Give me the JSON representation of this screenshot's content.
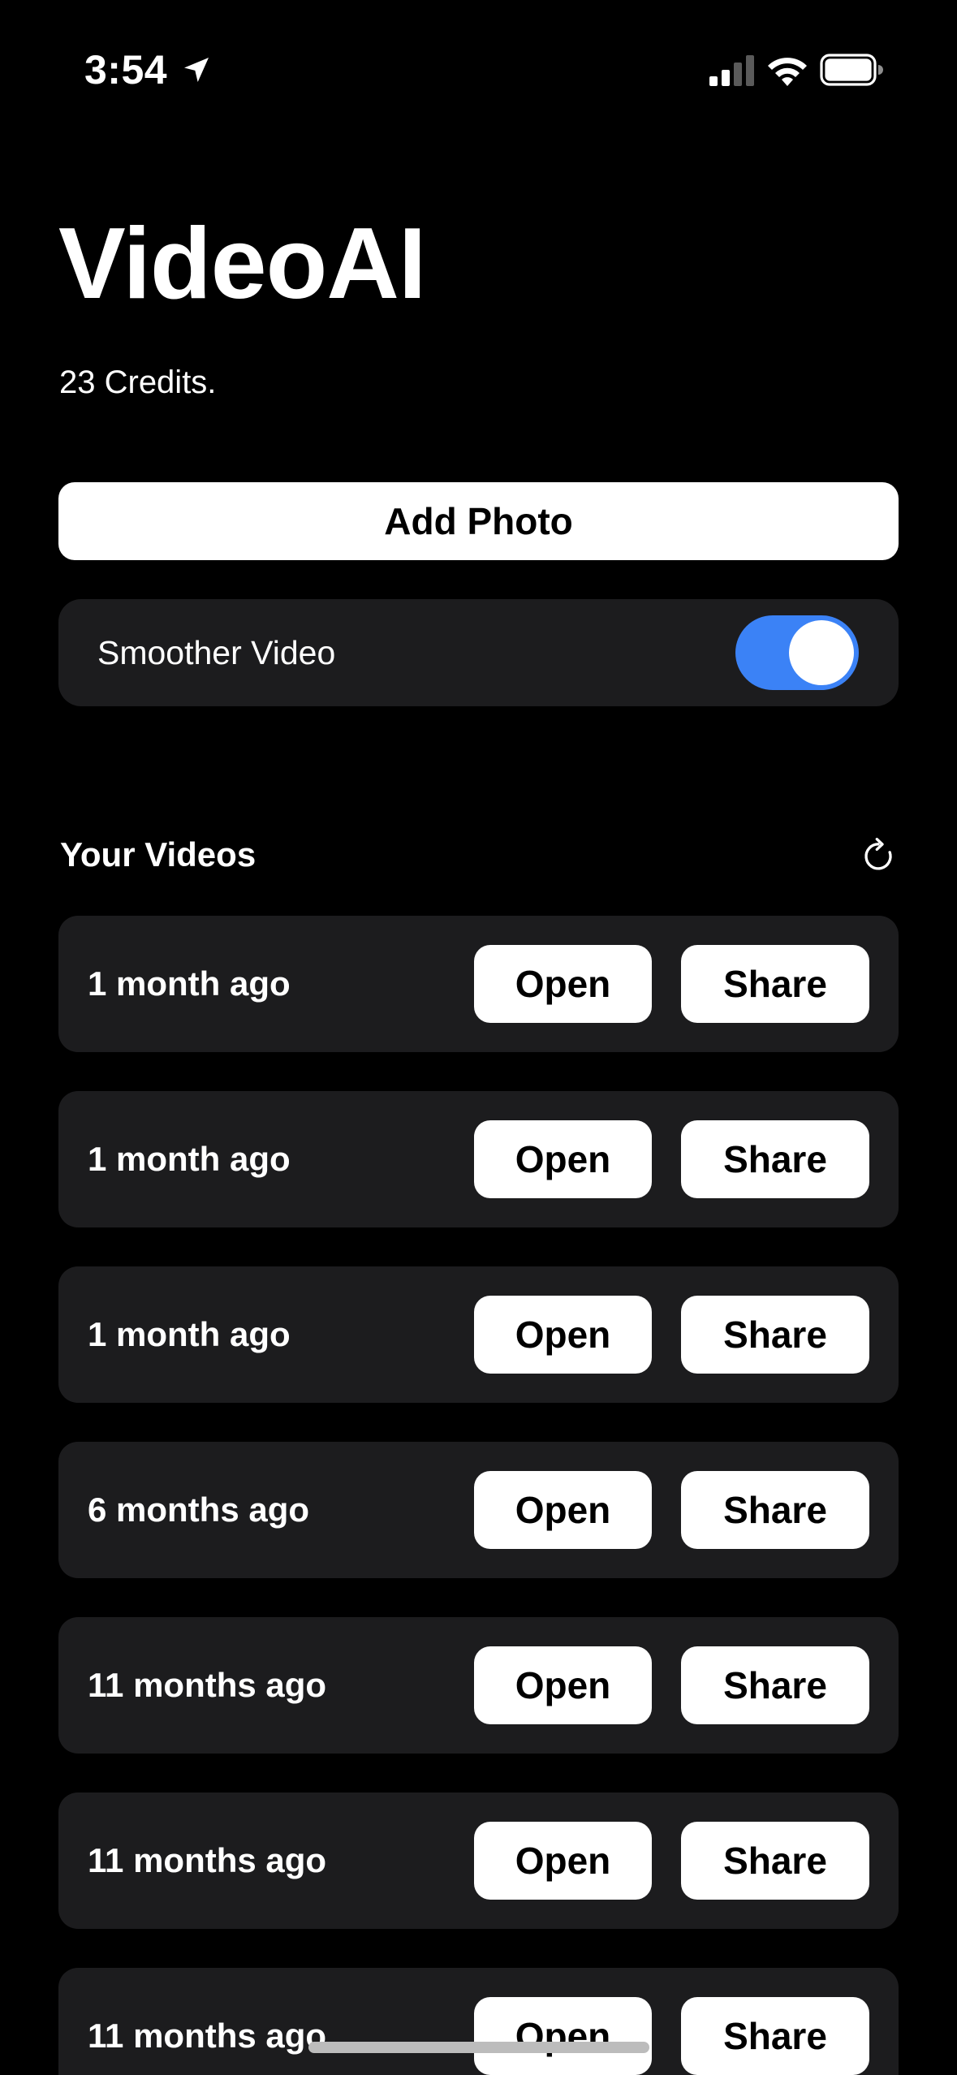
{
  "status_bar": {
    "time": "3:54",
    "icons": [
      "location-arrow-icon",
      "cellular-signal-icon",
      "wifi-icon",
      "battery-icon"
    ]
  },
  "header": {
    "title": "VideoAI",
    "credits": "23 Credits."
  },
  "add_photo": {
    "label": "Add Photo"
  },
  "smoother_video": {
    "label": "Smoother Video",
    "enabled": true,
    "accent": "#3b82f6"
  },
  "videos_section": {
    "title": "Your Videos",
    "refresh_icon": "refresh-icon",
    "items": [
      {
        "date": "1 month ago",
        "open_label": "Open",
        "share_label": "Share"
      },
      {
        "date": "1 month ago",
        "open_label": "Open",
        "share_label": "Share"
      },
      {
        "date": "1 month ago",
        "open_label": "Open",
        "share_label": "Share"
      },
      {
        "date": "6 months ago",
        "open_label": "Open",
        "share_label": "Share"
      },
      {
        "date": "11 months ago",
        "open_label": "Open",
        "share_label": "Share"
      },
      {
        "date": "11 months ago",
        "open_label": "Open",
        "share_label": "Share"
      },
      {
        "date": "11 months ago",
        "open_label": "Open",
        "share_label": "Share"
      }
    ]
  },
  "colors": {
    "background": "#000000",
    "card": "#1c1c1e",
    "button": "#ffffff"
  }
}
